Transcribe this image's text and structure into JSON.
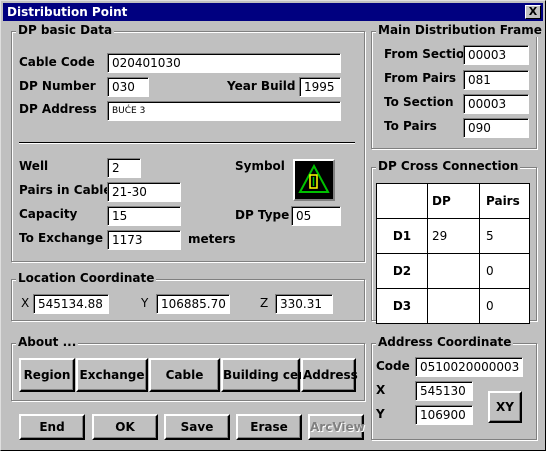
{
  "window": {
    "title": "Distribution Point",
    "close_label": "X"
  },
  "dp_basic": {
    "group_label": "DP basic Data",
    "cable_code_label": "Cable Code",
    "cable_code": "020401030",
    "dp_number_label": "DP Number",
    "dp_number": "030",
    "year_build_label": "Year Build",
    "year_build": "1995",
    "dp_address_label": "DP Address",
    "dp_address": "BUĆE 3",
    "well_label": "Well",
    "well": "2",
    "pairs_in_cable_label": "Pairs in Cable",
    "pairs_in_cable": "21-30",
    "capacity_label": "Capacity",
    "capacity": "15",
    "to_exchange_label": "To Exchange",
    "to_exchange": "1173",
    "to_exchange_unit": "meters",
    "symbol_label": "Symbol",
    "symbol_icon": "warning-triangle-icon",
    "dp_type_label": "DP Type",
    "dp_type": "05"
  },
  "main_frame": {
    "group_label": "Main Distribution Frame",
    "from_section_label": "From Section",
    "from_section": "00003",
    "from_pairs_label": "From Pairs",
    "from_pairs": "081",
    "to_section_label": "To Section",
    "to_section": "00003",
    "to_pairs_label": "To Pairs",
    "to_pairs": "090"
  },
  "cross_connection": {
    "group_label": "DP Cross Connection",
    "headers": [
      "",
      "DP",
      "Pairs"
    ],
    "rows": [
      [
        "D1",
        "29",
        "5"
      ],
      [
        "D2",
        "",
        "0"
      ],
      [
        "D3",
        "",
        "0"
      ]
    ]
  },
  "location": {
    "group_label": "Location Coordinate",
    "x_label": "X",
    "x": "545134.88",
    "y_label": "Y",
    "y": "106885.70",
    "z_label": "Z",
    "z": "330.31"
  },
  "about": {
    "group_label": "About ...",
    "buttons": [
      "Region",
      "Exchange",
      "Cable",
      "Building cen.",
      "Address"
    ]
  },
  "address_coord": {
    "group_label": "Address Coordinate",
    "code_label": "Code",
    "code": "0510020000003",
    "x_label": "X",
    "x": "545130",
    "y_label": "Y",
    "y": "106900",
    "xy_button": "XY"
  },
  "footer": {
    "buttons": [
      "End",
      "OK",
      "Save",
      "Erase",
      "ArcView"
    ]
  },
  "colors": {
    "title_bar": "#000080",
    "face": "#c0c0c0",
    "symbol_green": "#00c000",
    "symbol_yellow": "#ffff00"
  }
}
